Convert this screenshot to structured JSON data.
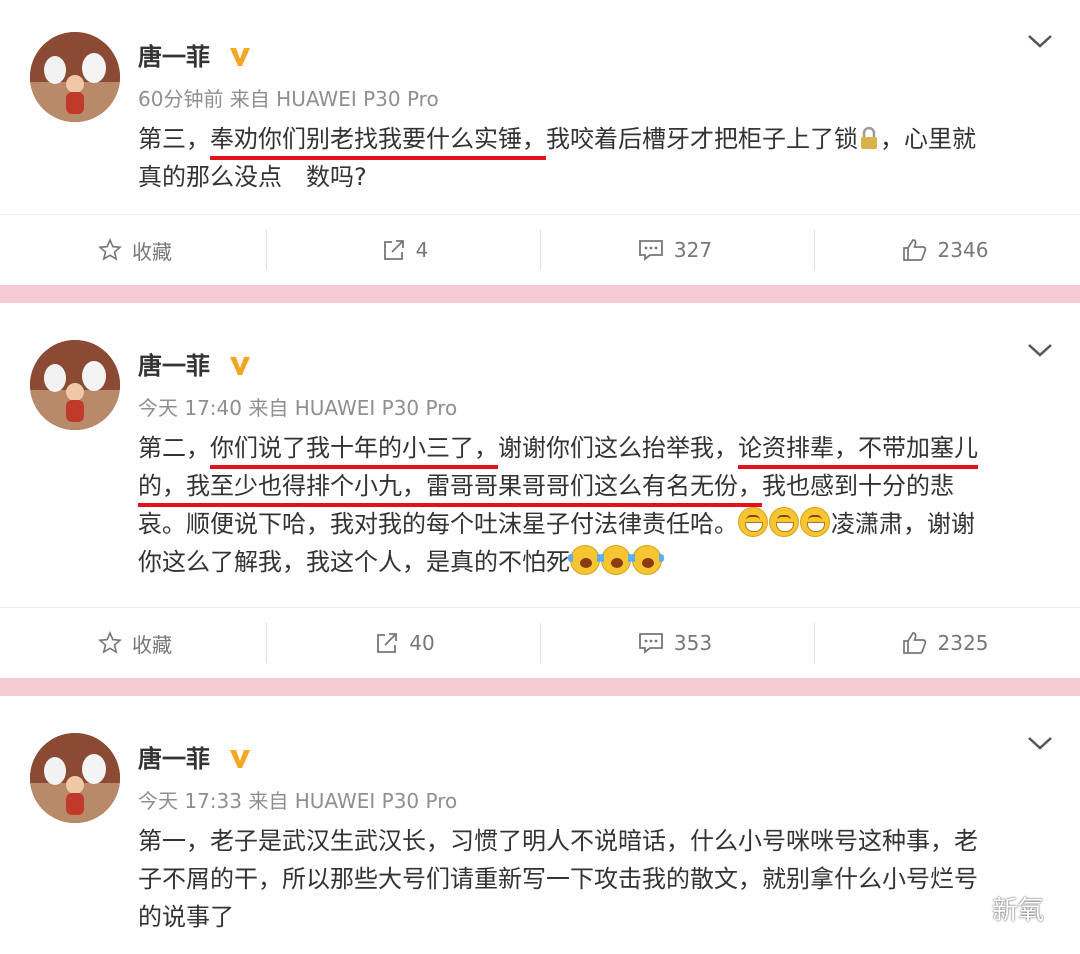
{
  "posts": [
    {
      "username": "唐一菲",
      "meta": "60分钟前 来自 HUAWEI P30 Pro",
      "lines": [
        [
          "第三，",
          "奉劝你们别老找我要什么实锤，",
          "我咬着后槽牙才把柜子上了锁",
          "",
          "，心里就"
        ],
        [
          "真的那么没点　数吗?"
        ]
      ],
      "actions": {
        "favorite": "收藏",
        "repost": "4",
        "comment": "327",
        "like": "2346"
      }
    },
    {
      "username": "唐一菲",
      "meta": "今天 17:40 来自 HUAWEI P30 Pro",
      "lines": [
        [
          "第二，",
          "你们说了我十年的小三了，",
          "谢谢你们这么抬举我，",
          "论资排辈，不带加塞儿"
        ],
        [
          "的，我至少也得排个小九，雷哥哥果哥哥们这么有名无份，",
          "我也感到十分的悲"
        ],
        [
          "哀。顺便说下哈，我对我的每个吐沫星子付法律责任哈。",
          "凌潇肃，谢谢"
        ],
        [
          "你这么了解我，我这个人，是真的不怕死"
        ]
      ],
      "actions": {
        "favorite": "收藏",
        "repost": "40",
        "comment": "353",
        "like": "2325"
      }
    },
    {
      "username": "唐一菲",
      "meta": "今天 17:33 来自 HUAWEI P30 Pro",
      "lines": [
        [
          "第一，老子是武汉生武汉长，习惯了明人不说暗话，什么小号咪咪号这种事，老"
        ],
        [
          "子不屑的干，所以那些大号们请重新写一下攻击我的散文，就别拿什么小号烂号"
        ],
        [
          "的说事了"
        ]
      ]
    }
  ],
  "watermark": "新氧",
  "colors": {
    "separator": "#f6cbd6",
    "underline": "#e3101e",
    "vip_badge": "#f5a623"
  },
  "icons": [
    "star-icon",
    "repost-icon",
    "comment-icon",
    "like-icon",
    "chevron-down-icon",
    "v-badge-icon",
    "lock-emoji-icon",
    "grin-emoji-icon",
    "laugh-cry-emoji-icon",
    "wechat-icon"
  ]
}
